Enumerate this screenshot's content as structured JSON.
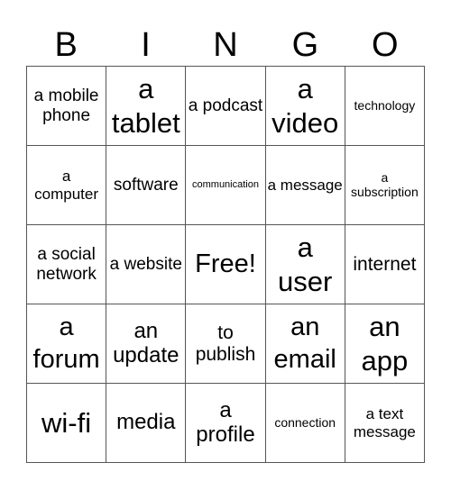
{
  "header": {
    "letters": [
      "B",
      "I",
      "N",
      "G",
      "O"
    ]
  },
  "card": {
    "cells": [
      [
        "a mobile phone",
        "a tablet",
        "a podcast",
        "a video",
        "technology"
      ],
      [
        "a computer",
        "software",
        "communication",
        "a message",
        "a subscription"
      ],
      [
        "a social network",
        "a website",
        "Free!",
        "a user",
        "internet"
      ],
      [
        "a forum",
        "an update",
        "to publish",
        "an email",
        "an app"
      ],
      [
        "wi-fi",
        "media",
        "a profile",
        "connection",
        "a text message"
      ]
    ],
    "free_space": "Free!"
  }
}
